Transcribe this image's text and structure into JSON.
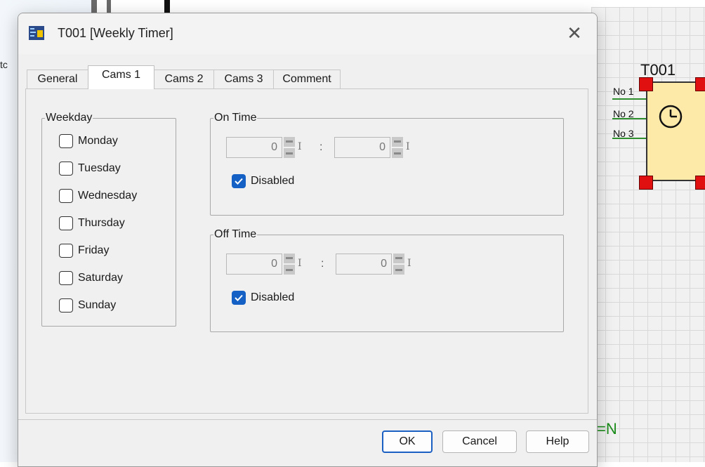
{
  "dialog": {
    "title": "T001 [Weekly Timer]",
    "close_glyph": "✕",
    "tabs": [
      {
        "label": "General",
        "active": false
      },
      {
        "label": "Cams 1",
        "active": true
      },
      {
        "label": "Cams 2",
        "active": false
      },
      {
        "label": "Cams 3",
        "active": false
      },
      {
        "label": "Comment",
        "active": false
      }
    ],
    "weekday": {
      "legend": "Weekday",
      "days": [
        {
          "label": "Monday",
          "checked": false
        },
        {
          "label": "Tuesday",
          "checked": false
        },
        {
          "label": "Wednesday",
          "checked": false
        },
        {
          "label": "Thursday",
          "checked": false
        },
        {
          "label": "Friday",
          "checked": false
        },
        {
          "label": "Saturday",
          "checked": false
        },
        {
          "label": "Sunday",
          "checked": false
        }
      ]
    },
    "on_time": {
      "legend": "On Time",
      "hours": "0",
      "minutes": "0",
      "suffix": "I",
      "separator": ":",
      "disabled_label": "Disabled",
      "disabled_checked": true
    },
    "off_time": {
      "legend": "Off Time",
      "hours": "0",
      "minutes": "0",
      "suffix": "I",
      "separator": ":",
      "disabled_label": "Disabled",
      "disabled_checked": true
    },
    "buttons": {
      "ok": "OK",
      "cancel": "Cancel",
      "help": "Help"
    }
  },
  "background": {
    "block": {
      "title": "T001",
      "pins": [
        "No 1",
        "No 2",
        "No 3"
      ],
      "icon": "clock-icon"
    },
    "equation_text": "=N",
    "stub_text": "tc"
  },
  "colors": {
    "accent": "#1560c4",
    "block_fill": "#fde9a8",
    "handle": "#e01010",
    "signal_green": "#1a8c1a"
  }
}
